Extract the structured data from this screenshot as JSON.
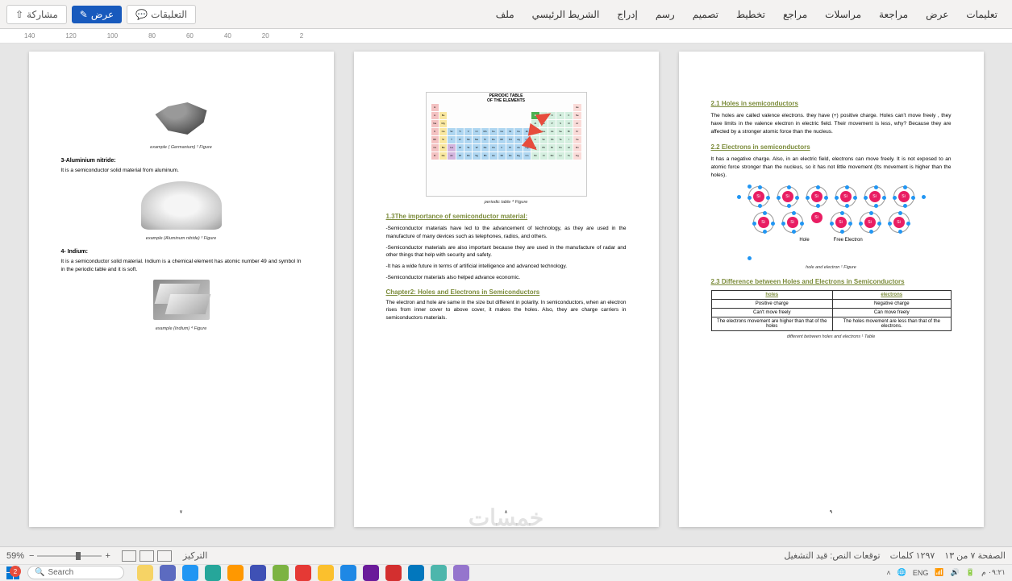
{
  "toolbar": {
    "share": "مشاركة",
    "view": "عرض",
    "comments": "التعليقات",
    "tabs": [
      "ملف",
      "الشريط الرئيسي",
      "إدراج",
      "رسم",
      "تصميم",
      "تخطيط",
      "مراجع",
      "مراسلات",
      "مراجعة",
      "عرض",
      "تعليمات"
    ]
  },
  "ruler_marks": [
    "140",
    "120",
    "100",
    "80",
    "60",
    "40",
    "20",
    "2"
  ],
  "page7": {
    "img1_caption": "example ( Germanium) ² Figure",
    "h_aln": "3-Aluminium nitride:",
    "p_aln": "It is a semiconductor solid material from aluminum.",
    "img2_caption": "example (Aluminum nitride) ³ Figure",
    "h_in": "4- Indium:",
    "p_in": "It is a semiconductor solid material. Indium is a chemical element has atomic number 49 and symbol In in the periodic table and it is soft.",
    "img3_caption": "example (Indium) ⁴ Figure",
    "num": "٧"
  },
  "page8": {
    "pt_title1": "PERIODIC TABLE",
    "pt_title2": "OF THE ELEMENTS",
    "pt_caption": "periodic table ⁴ Figure",
    "h_importance": "1.3The importance of semiconductor material:",
    "bul1": "-Semiconductor materials have led to the advancement of technology, as they are used in the manufacture of many devices such as telephones, radios, and others.",
    "bul2": "-Semiconductor materials are also important because they are used in the manufacture of radar and other things that help with security and safety.",
    "bul3": "-It has a wide future in terms of artificial intelligence and advanced technology.",
    "bul4": "-Semiconductor materials also helped advance economic.",
    "h_ch2": "Chapter2: Holes and Electrons in Semiconductors",
    "p_ch2": "The electron and hole are same in the size but different in polarity. In semiconductors, when an electron rises from inner cover to above cover, it makes the holes. Also, they are charge carriers in semiconductors materials.",
    "num": "٨"
  },
  "page9": {
    "h21": "2.1 Holes in semiconductors",
    "p21": "The holes are called valence electrons. they have (+) positive charge. Holes can't move freely , they have limits in the valence electron in electric field. Their movement is less, why?  Because they are affected by a stronger atomic force than the nucleus.",
    "h22": "2.2 Electrons in semiconductors",
    "p22": "It has a negative charge. Also, in an electric field, electrons can move freely. It is not exposed to an atomic force stronger than the nucleus, so it has not little movement (Its movement is higher than the holes).",
    "lat_hole": "Hole",
    "lat_free": "Free Electron",
    "lat_caption": "hole and electron ¹ Figure",
    "h23": "2.3 Difference between Holes and Electrons in Semiconductors",
    "table": {
      "th1": "holes",
      "th2": "electrons",
      "r1c1": "Positive charge",
      "r1c2": "Negative charge",
      "r2c1": "Can't move freely",
      "r2c2": "Can move freely",
      "r3c1": "The electrons movement are higher than that of the holes",
      "r3c2": "The holes movement are less than that of the electrons."
    },
    "table_caption": "different between holes and electrons ¹ Table",
    "num": "٩"
  },
  "status": {
    "zoom": "59%",
    "focus": "التركيز",
    "prediction": "توقعات النص: قيد التشغيل",
    "words": "١٢٩٧ كلمات",
    "pagepos": "الصفحة ٧ من ١٣"
  },
  "taskbar": {
    "search": "Search",
    "lang": "ENG",
    "time": "٠٩:٢١ م",
    "badge": "2"
  },
  "watermark": "خمسات"
}
